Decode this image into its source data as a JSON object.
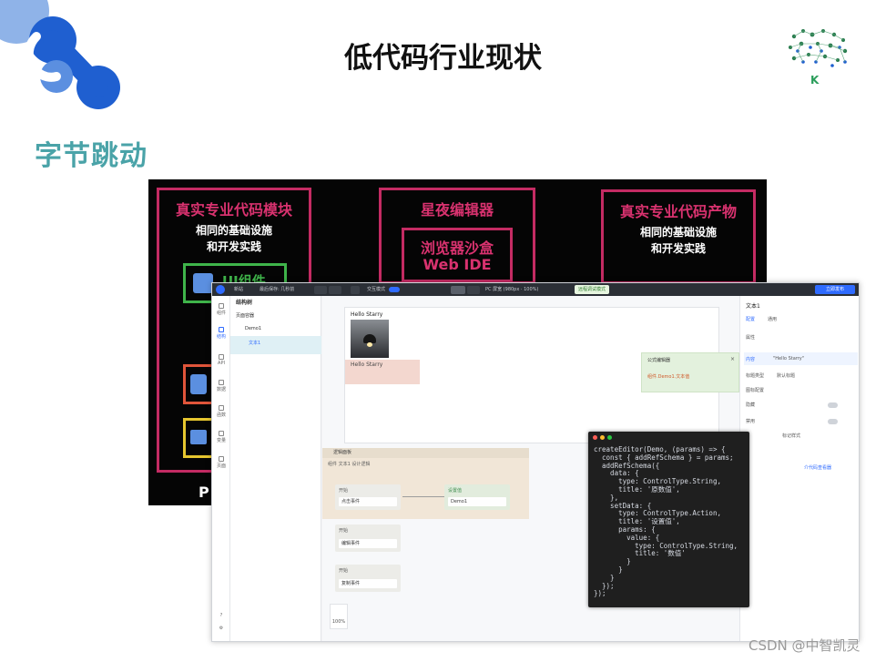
{
  "slide": {
    "title": "低代码行业现状",
    "company": "字节跳动",
    "watermark": "CSDN @中智凯灵",
    "logo_letter": "K",
    "accent": "#4aa3a8",
    "brand_blue": "#1f5fd0"
  },
  "diagram": {
    "left": {
      "title": "真实专业代码模块",
      "line1": "相同的基础设施",
      "line2": "和开发实践",
      "module": "UI组件"
    },
    "middle": {
      "title": "星夜编辑器",
      "sub1": "浏览器沙盒",
      "sub2": "Web IDE"
    },
    "right": {
      "title": "真实专业代码产物",
      "line1": "相同的基础设施",
      "line2": "和开发实践"
    },
    "bottom_letter": "P"
  },
  "ide": {
    "topbar": {
      "title": "新站",
      "saved": "最后保存: 几秒前",
      "mode": "交互模式",
      "device": "PC 屏宽 (980px · 100%)",
      "remote": "远程调试模式",
      "publish": "立即发布"
    },
    "nav": [
      "组件",
      "结构",
      "API",
      "数据",
      "函数",
      "变量",
      "页面"
    ],
    "tree": {
      "header": "结构树",
      "container": "页面容器",
      "demo": "Demo1",
      "text": "文本1"
    },
    "canvas": {
      "hello1": "Hello Starry",
      "hello2": "Hello Starry",
      "zoom": "100%"
    },
    "formula": {
      "title": "公式编辑器",
      "expr": "组件.Demo1.文本值"
    },
    "logic": {
      "header": "逻辑面板",
      "path": "组件 文本1 设计逻辑",
      "node1_label": "开始",
      "node1_value": "点击事件",
      "node2_label": "设置值",
      "node2_value": "Demo1",
      "node3_label": "开始",
      "node3_value": "编辑事件",
      "node4_label": "开始",
      "node4_value": "复制事件"
    },
    "right": {
      "header": "文本1",
      "tab1": "配置",
      "tab2": "通用",
      "section": "属性",
      "content_label": "内容",
      "content_value": "\"Hello Starry\"",
      "type_label": "标题类型",
      "type_value": "默认标题",
      "icon_cfg": "图标配置",
      "hide": "隐藏",
      "disable": "禁用",
      "style": "标记样式",
      "link": "介代码查看器"
    }
  },
  "code": {
    "lines": [
      "createEditor(Demo, (params) => {",
      "  const { addRefSchema } = params;",
      "  addRefSchema({",
      "    data: {",
      "      type: ControlType.String,",
      "      title: '原数值',",
      "    },",
      "    setData: {",
      "      type: ControlType.Action,",
      "      title: '设置值',",
      "      params: {",
      "        value: {",
      "          type: ControlType.String,",
      "          title: '数值'",
      "        }",
      "      }",
      "    }",
      "  });",
      "});"
    ]
  }
}
